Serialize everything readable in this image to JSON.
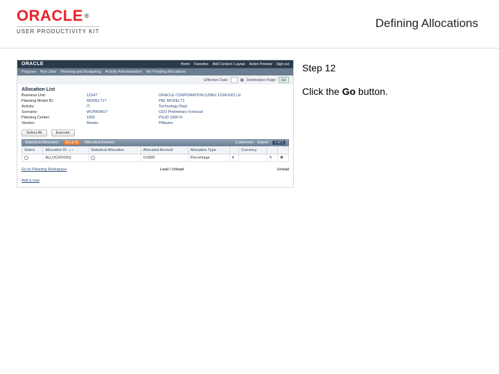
{
  "header": {
    "brand": "ORACLE",
    "subhead": "USER PRODUCTIVITY KIT",
    "page_title": "Defining Allocations"
  },
  "instruction": {
    "step_label": "Step 12",
    "pre": "Click the ",
    "bold": "Go",
    "post": " button."
  },
  "app": {
    "brand": "ORACLE",
    "title_links": [
      "Home",
      "Favorites",
      "Add Content / Layout",
      "Action Preview",
      "Sign out"
    ],
    "tabs": [
      "Program",
      "Run Jobs",
      "Planning and Budgeting",
      "Activity Administration",
      "My Pending Allocations"
    ],
    "crumb": {
      "effective_lbl": "Effective Date",
      "effective_val": "",
      "destination_lbl": "Destination Page",
      "go": "Go"
    },
    "section_title": "Allocation List",
    "meta": [
      {
        "lbl": "Business Unit:",
        "val": "1234?",
        "val2": "ORACLE CORPORATION (USBU 1234USD) LE"
      },
      {
        "lbl": "Planning Model ID:",
        "val": "MODEL?1?",
        "val2": "PBL MODEL?1"
      },
      {
        "lbl": "Activity:",
        "val": "IT",
        "val2": "Technology Dept"
      },
      {
        "lbl": "Scenario:",
        "val": "WORKING?",
        "val2": "CEO Preliminary Forecast"
      },
      {
        "lbl": "Planning Center:",
        "val": "1000",
        "val2": "PGJD 1000 N"
      },
      {
        "lbl": "Version:",
        "val": "Master",
        "val2": "PMaster"
      }
    ],
    "buttons": {
      "select_all": "Select All",
      "execute": "Execute"
    },
    "tbar": {
      "stat_alloc": "Statistical Allocation",
      "delete": "DELETE",
      "alloc_amount": "Allocated Amount",
      "customize": "Customize",
      "export": "Export",
      "pager": "1 of 1"
    },
    "columns": [
      "Select",
      "Allocation ID",
      "Statistical Allocation",
      "Allocated Amount",
      "Allocation Type",
      "",
      "Currency",
      "",
      ""
    ],
    "row": {
      "alloc_id": "ALLOCATION1",
      "stat": "",
      "amount": "0.0000",
      "type": "Percentage",
      "currency": ""
    },
    "footer": {
      "goto": "Go to Planning Workspace",
      "load": "Load / Unload",
      "unload": "Unload"
    },
    "add": "Add a new"
  }
}
